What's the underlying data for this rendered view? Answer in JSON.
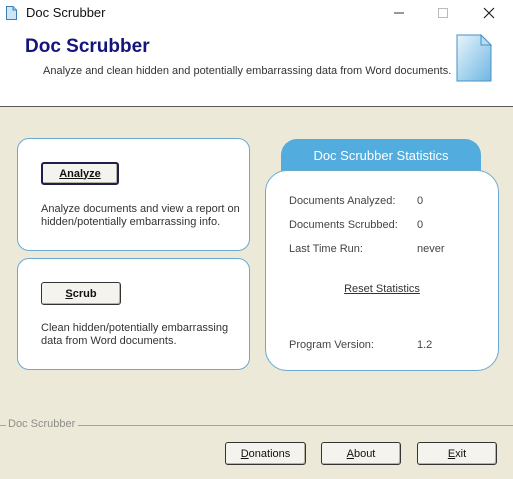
{
  "window": {
    "title": "Doc Scrubber"
  },
  "header": {
    "title": "Doc Scrubber",
    "subtitle": "Analyze and clean hidden and potentially embarrassing data from Word documents."
  },
  "analyze": {
    "button_label": "Analyze",
    "mnemonic": "A",
    "description": "Analyze documents and view a report on hidden/potentially embarrassing info."
  },
  "scrub": {
    "button_label": "Scrub",
    "mnemonic": "S",
    "description": "Clean hidden/potentially embarrassing data from Word documents."
  },
  "stats": {
    "title": "Doc Scrubber Statistics",
    "rows": [
      {
        "label": "Documents Analyzed:",
        "value": "0"
      },
      {
        "label": "Documents Scrubbed:",
        "value": "0"
      },
      {
        "label": "Last Time Run:",
        "value": "never"
      }
    ],
    "reset_link": "Reset Statistics",
    "version": {
      "label": "Program Version:",
      "value": "1.2"
    }
  },
  "footer": {
    "group_label": "Doc Scrubber",
    "donations_label": "Donations",
    "about_label": "About",
    "exit_label": "Exit"
  },
  "colors": {
    "title_blue": "#14147a",
    "stats_tab": "#53acde",
    "panel_border": "#6aa9d4",
    "body_bg": "#ece9d8"
  },
  "icons": {
    "app": "document-icon",
    "header": "document-icon",
    "window_controls": [
      "minimize-icon",
      "maximize-icon",
      "close-icon"
    ]
  }
}
